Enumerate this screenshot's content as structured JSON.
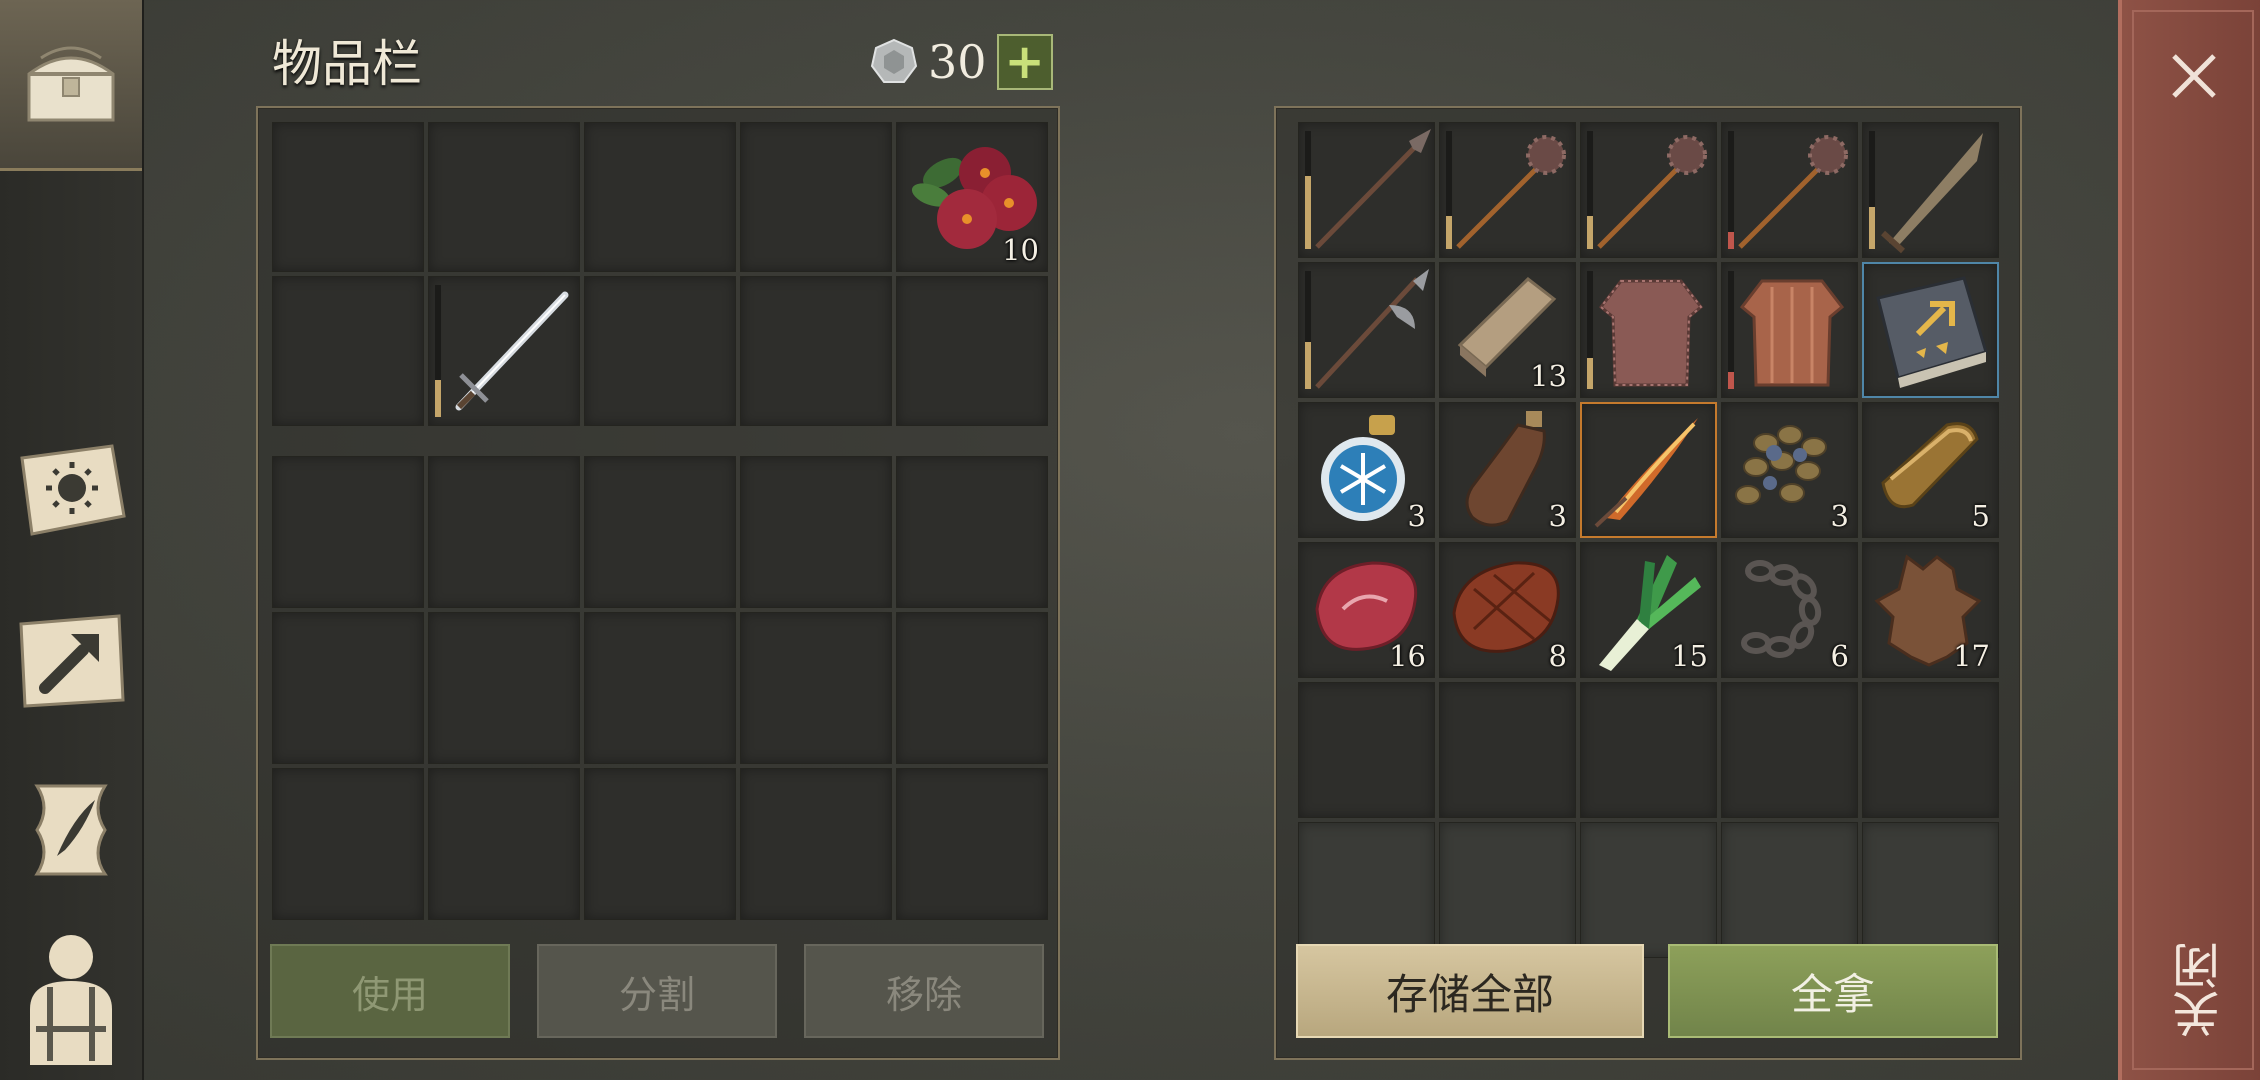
{
  "inventory": {
    "title": "物品栏",
    "silver_amount": "30",
    "add_label": "+",
    "item_fruit_qty": "10",
    "buttons": {
      "use": "使用",
      "split": "分割",
      "remove": "移除"
    }
  },
  "storage": {
    "quantities": {
      "wood": "13",
      "potion": "3",
      "flask": "3",
      "seeds": "3",
      "ingot": "5",
      "raw_meat": "16",
      "cooked_meat": "8",
      "leek": "15",
      "chain": "6",
      "hide": "17"
    },
    "buttons": {
      "store_all": "存储全部",
      "take_all": "全拿"
    }
  },
  "close_label": "关闭",
  "colors": {
    "accent_green": "#7f9450",
    "close_red": "#8e5246",
    "parchment": "#c9b98f"
  }
}
